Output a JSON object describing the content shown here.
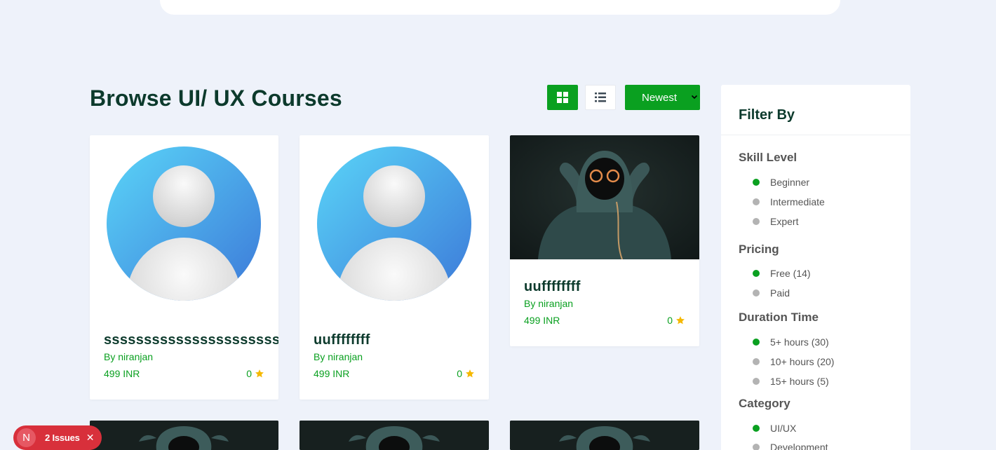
{
  "page": {
    "title": "Browse UI/ UX Courses"
  },
  "toolbar": {
    "grid_icon": "grid-view-icon",
    "list_icon": "list-view-icon",
    "sort_value": "Newest"
  },
  "courses": [
    {
      "title": "sssssssssssssssssssssssss",
      "author": "By niranjan",
      "price": "499 INR",
      "rating": "0",
      "image": "default-avatar"
    },
    {
      "title": "uuffffffff",
      "author": "By niranjan",
      "price": "499 INR",
      "rating": "0",
      "image": "default-avatar"
    },
    {
      "title": "uuffffffff",
      "author": "By niranjan",
      "price": "499 INR",
      "rating": "0",
      "image": "hooded-figure"
    },
    {
      "image": "hooded-figure"
    },
    {
      "image": "hooded-figure"
    },
    {
      "image": "hooded-figure"
    }
  ],
  "filter": {
    "title": "Filter By",
    "groups": [
      {
        "title": "Skill Level",
        "items": [
          {
            "label": "Beginner",
            "active": true
          },
          {
            "label": "Intermediate",
            "active": false
          },
          {
            "label": "Expert",
            "active": false
          }
        ]
      },
      {
        "title": "Pricing",
        "items": [
          {
            "label": "Free (14)",
            "active": true
          },
          {
            "label": "Paid",
            "active": false
          }
        ]
      },
      {
        "title": "Duration Time",
        "items": [
          {
            "label": "5+ hours (30)",
            "active": true
          },
          {
            "label": "10+ hours (20)",
            "active": false
          },
          {
            "label": "15+ hours (5)",
            "active": false
          }
        ]
      },
      {
        "title": "Category",
        "items": [
          {
            "label": "UI/UX",
            "active": true
          },
          {
            "label": "Development",
            "active": false
          }
        ]
      }
    ]
  },
  "dev_overlay": {
    "logo_letter": "N",
    "label": "2 Issues",
    "close": "✕"
  },
  "colors": {
    "accent": "#0aa020",
    "heading": "#0c3a2c",
    "background": "#eef2fa",
    "issues_badge": "#d8303b"
  }
}
